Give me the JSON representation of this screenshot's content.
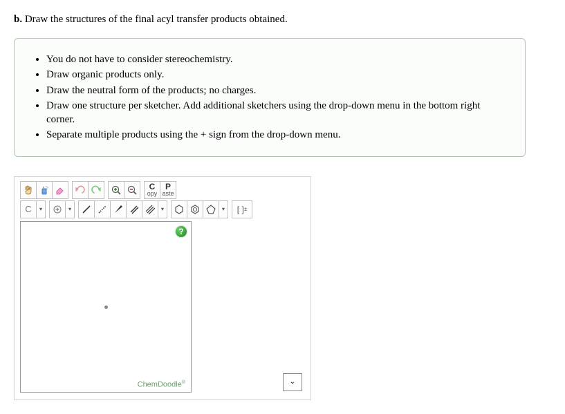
{
  "question": {
    "part_letter": "b.",
    "prompt_text": "Draw the structures of the final acyl transfer products obtained."
  },
  "instructions": [
    "You do not have to consider stereochemistry.",
    "Draw organic products only.",
    "Draw the neutral form of the products; no charges.",
    "Draw one structure per sketcher. Add additional sketchers using the drop-down menu in the bottom right corner.",
    "Separate multiple products using the + sign from the drop-down menu."
  ],
  "toolbar": {
    "copy_big": "C",
    "copy_small": "opy",
    "paste_big": "P",
    "paste_small": "aste",
    "element_label": "C",
    "bracket_label": "[ ]",
    "bracket_pm": "±"
  },
  "sketcher": {
    "help_label": "?",
    "brand": "ChemDoodle",
    "brand_reg": "®"
  }
}
